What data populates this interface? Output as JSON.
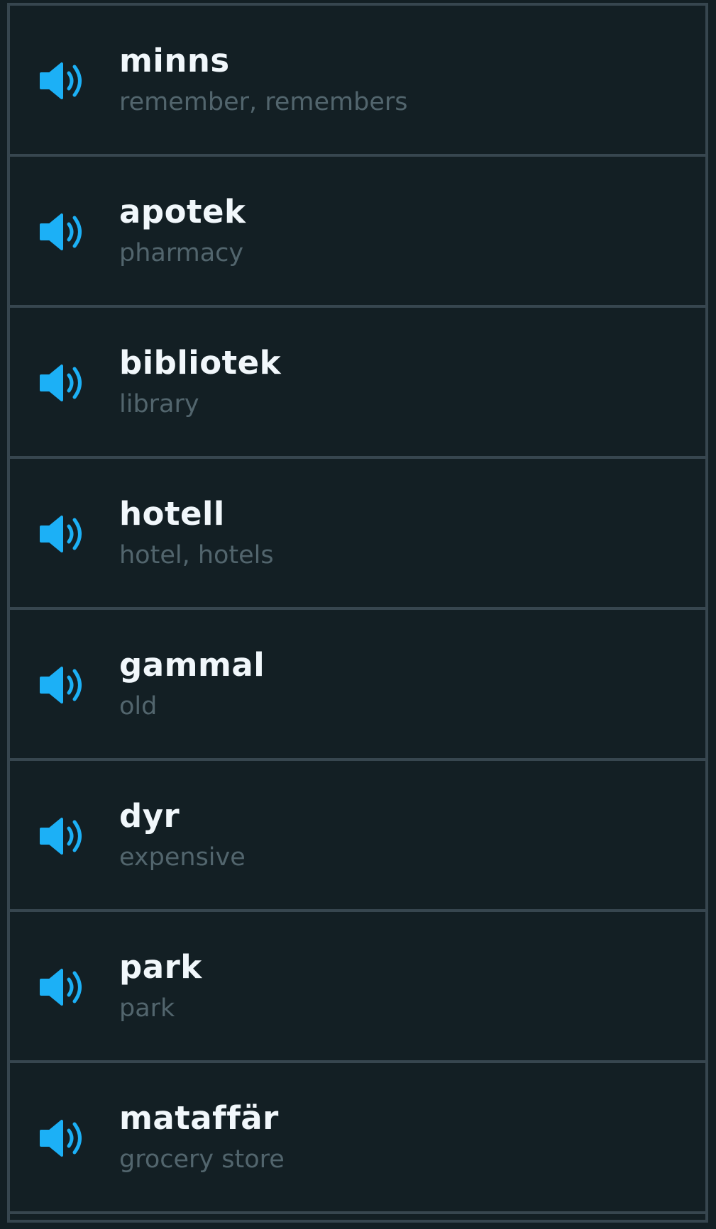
{
  "colors": {
    "background": "#131f24",
    "border": "#37464f",
    "word": "#f1f7fb",
    "meaning": "#52656d",
    "speaker": "#1cb0f6"
  },
  "word_list": {
    "items": [
      {
        "word": "minns",
        "meaning": "remember, remembers",
        "icon": "speaker-icon"
      },
      {
        "word": "apotek",
        "meaning": "pharmacy",
        "icon": "speaker-icon"
      },
      {
        "word": "bibliotek",
        "meaning": "library",
        "icon": "speaker-icon"
      },
      {
        "word": "hotell",
        "meaning": "hotel, hotels",
        "icon": "speaker-icon"
      },
      {
        "word": "gammal",
        "meaning": "old",
        "icon": "speaker-icon"
      },
      {
        "word": "dyr",
        "meaning": "expensive",
        "icon": "speaker-icon"
      },
      {
        "word": "park",
        "meaning": "park",
        "icon": "speaker-icon"
      },
      {
        "word": "mataffär",
        "meaning": "grocery store",
        "icon": "speaker-icon"
      }
    ]
  }
}
